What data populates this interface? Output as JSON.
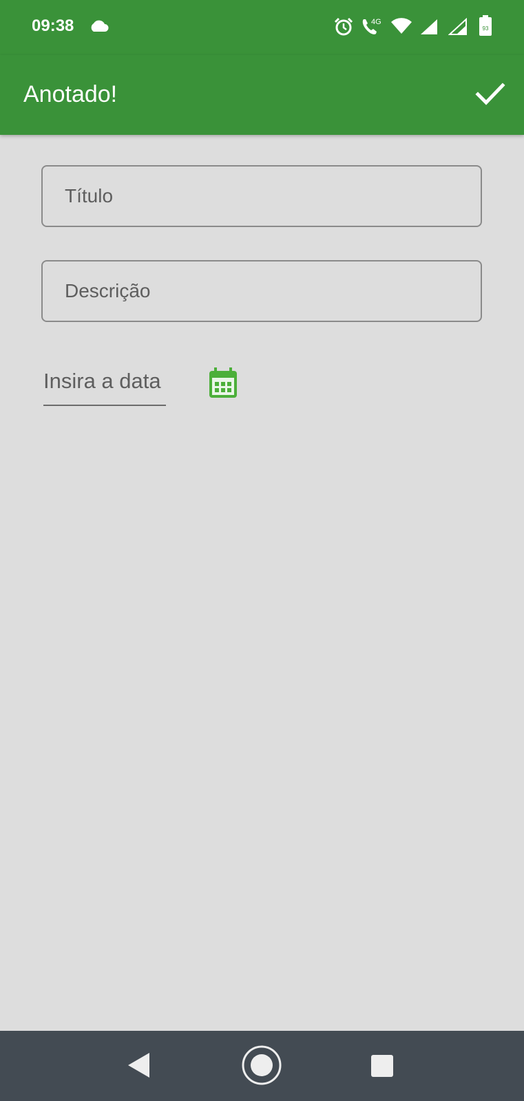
{
  "status_bar": {
    "time": "09:38",
    "battery_level": "93",
    "network": "4G",
    "icons": [
      "cloud-icon",
      "alarm-icon",
      "volte-call-icon",
      "wifi-icon",
      "signal-icon",
      "signal-icon",
      "battery-icon"
    ]
  },
  "app_bar": {
    "title": "Anotado!",
    "action_icon": "check-icon"
  },
  "form": {
    "title_placeholder": "Título",
    "description_placeholder": "Descrição",
    "date_placeholder": "Insira a data",
    "date_icon": "calendar-icon"
  },
  "nav_bar": {
    "icons": [
      "back-icon",
      "home-icon",
      "recents-icon"
    ]
  },
  "colors": {
    "primary": "#3a9239",
    "calendar_icon": "#4caf3a",
    "background": "#dddddd",
    "nav_bar": "#434b53"
  }
}
